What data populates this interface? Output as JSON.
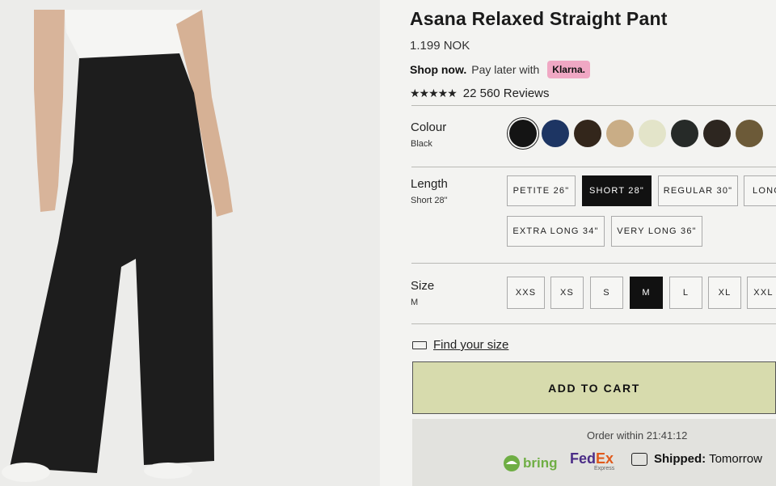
{
  "product": {
    "title": "Asana Relaxed Straight Pant",
    "price": "1.199 NOK",
    "shop_now": "Shop now.",
    "pay_later": "Pay later with",
    "klarna": "Klarna.",
    "stars": "★★★★★",
    "reviews": "22 560 Reviews"
  },
  "colour": {
    "label": "Colour",
    "selected": "Black",
    "swatches": [
      {
        "name": "black",
        "hex": "#141414",
        "selected": true
      },
      {
        "name": "navy",
        "hex": "#1d3563"
      },
      {
        "name": "dark-brown",
        "hex": "#33261b"
      },
      {
        "name": "tan",
        "hex": "#c9ad86"
      },
      {
        "name": "cream",
        "hex": "#e3e4c9"
      },
      {
        "name": "charcoal",
        "hex": "#262a28"
      },
      {
        "name": "espresso",
        "hex": "#2d2620"
      },
      {
        "name": "olive-brown",
        "hex": "#6c5a38"
      }
    ]
  },
  "length": {
    "label": "Length",
    "selected": "Short 28\"",
    "options": [
      "PETITE 26\"",
      "SHORT 28\"",
      "REGULAR 30\"",
      "LONG",
      "EXTRA LONG 34\"",
      "VERY LONG 36\""
    ]
  },
  "size": {
    "label": "Size",
    "selected": "M",
    "options": [
      "XXS",
      "XS",
      "S",
      "M",
      "L",
      "XL",
      "XXL"
    ]
  },
  "find_size": "Find your size",
  "add_to_cart": "ADD TO CART",
  "delivery": {
    "order_within": "Order within 21:41:12",
    "bring": "bring",
    "fedex_fe": "Fed",
    "fedex_ex": "Ex",
    "fedex_express": "Express",
    "shipped_label": "Shipped:",
    "shipped_value": "Tomorrow"
  }
}
